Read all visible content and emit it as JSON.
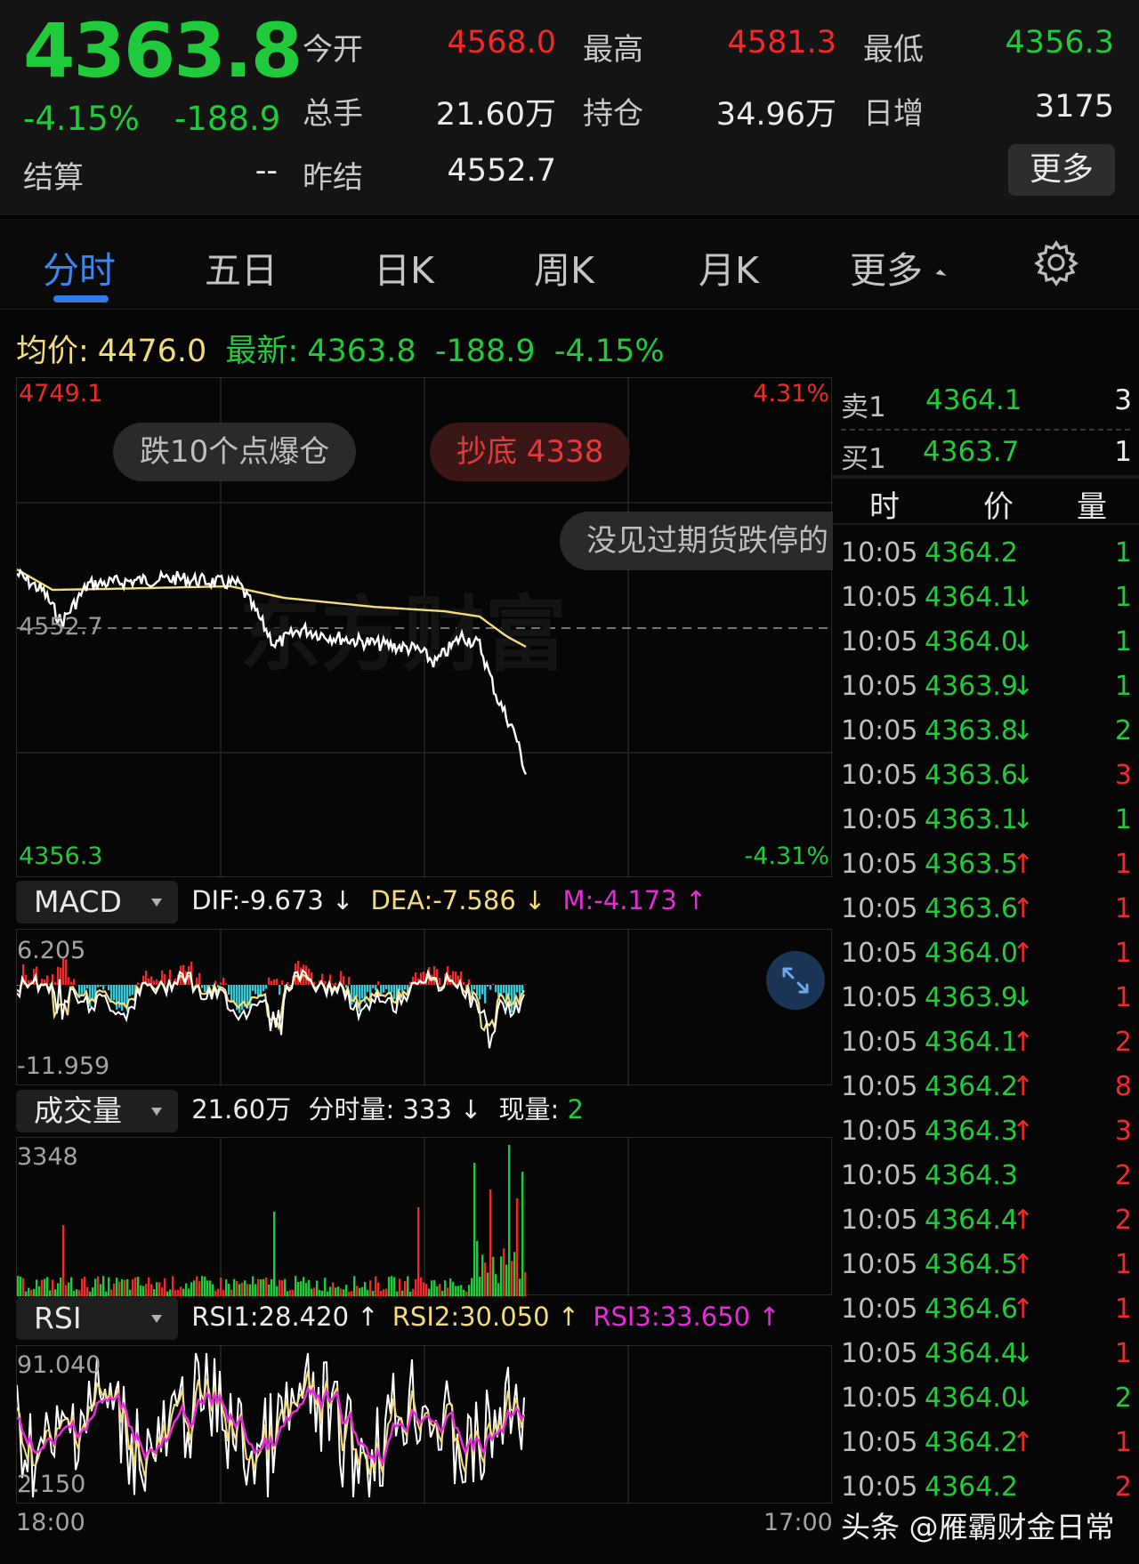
{
  "header": {
    "last_price": "4363.8",
    "change_pct": "-4.15%",
    "change_abs": "-188.9",
    "open_label": "今开",
    "open_value": "4568.0",
    "high_label": "最高",
    "high_value": "4581.3",
    "low_label": "最低",
    "low_value": "4356.3",
    "volume_label": "总手",
    "volume_value": "21.60万",
    "oi_label": "持仓",
    "oi_value": "34.96万",
    "daily_inc_label": "日增",
    "daily_inc_value": "3175",
    "settle_label": "结算",
    "settle_value": "--",
    "prev_settle_label": "昨结",
    "prev_settle_value": "4552.7",
    "more_label": "更多"
  },
  "tabs": [
    "分时",
    "五日",
    "日K",
    "周K",
    "月K",
    "更多"
  ],
  "info_line": {
    "avg_label": "均价:",
    "avg_value": "4476.0",
    "latest_label": "最新:",
    "latest_value": "4363.8",
    "latest_change": "-188.9",
    "latest_pct": "-4.15%"
  },
  "price_chart": {
    "y_max": "4749.1",
    "y_min": "4356.3",
    "pct_max": "4.31%",
    "pct_min": "-4.31%",
    "ref_price": "4552.7",
    "watermark": "东方财富",
    "comments": [
      "跌10个点爆仓",
      "抄底 4338",
      "没见过期货跌停的"
    ]
  },
  "macd": {
    "name": "MACD",
    "dif": "DIF:-9.673 ↓",
    "dea": "DEA:-7.586 ↓",
    "m": "M:-4.173 ↑",
    "y_max": "6.205",
    "y_min": "-11.959"
  },
  "volume": {
    "name": "成交量",
    "total": "21.60万",
    "period_vol": "分时量: 333 ↓",
    "now_label": "现量:",
    "now_value": "2",
    "y_max": "3348"
  },
  "rsi": {
    "name": "RSI",
    "rsi1": "RSI1:28.420 ↑",
    "rsi2": "RSI2:30.050 ↑",
    "rsi3": "RSI3:33.650 ↑",
    "y_max": "91.040",
    "y_min": "2.150"
  },
  "x_axis": {
    "start": "18:00",
    "end": "17:00"
  },
  "order_book": {
    "ask1_label": "卖1",
    "ask1_price": "4364.1",
    "ask1_qty": "3",
    "bid1_label": "买1",
    "bid1_price": "4363.7",
    "bid1_qty": "1",
    "col_time": "时",
    "col_price": "价",
    "col_qty": "量"
  },
  "trades": [
    {
      "time": "10:05",
      "price": "4364.2",
      "dir": "",
      "qty": "1",
      "qty_color": "green"
    },
    {
      "time": "10:05",
      "price": "4364.1",
      "dir": "↓",
      "qty": "1",
      "qty_color": "green"
    },
    {
      "time": "10:05",
      "price": "4364.0",
      "dir": "↓",
      "qty": "1",
      "qty_color": "green"
    },
    {
      "time": "10:05",
      "price": "4363.9",
      "dir": "↓",
      "qty": "1",
      "qty_color": "green"
    },
    {
      "time": "10:05",
      "price": "4363.8",
      "dir": "↓",
      "qty": "2",
      "qty_color": "green"
    },
    {
      "time": "10:05",
      "price": "4363.6",
      "dir": "↓",
      "qty": "3",
      "qty_color": "red"
    },
    {
      "time": "10:05",
      "price": "4363.1",
      "dir": "↓",
      "qty": "1",
      "qty_color": "green"
    },
    {
      "time": "10:05",
      "price": "4363.5",
      "dir": "↑",
      "qty": "1",
      "qty_color": "red"
    },
    {
      "time": "10:05",
      "price": "4363.6",
      "dir": "↑",
      "qty": "1",
      "qty_color": "red"
    },
    {
      "time": "10:05",
      "price": "4364.0",
      "dir": "↑",
      "qty": "1",
      "qty_color": "red"
    },
    {
      "time": "10:05",
      "price": "4363.9",
      "dir": "↓",
      "qty": "1",
      "qty_color": "red"
    },
    {
      "time": "10:05",
      "price": "4364.1",
      "dir": "↑",
      "qty": "2",
      "qty_color": "red"
    },
    {
      "time": "10:05",
      "price": "4364.2",
      "dir": "↑",
      "qty": "8",
      "qty_color": "red"
    },
    {
      "time": "10:05",
      "price": "4364.3",
      "dir": "↑",
      "qty": "3",
      "qty_color": "red"
    },
    {
      "time": "10:05",
      "price": "4364.3",
      "dir": "",
      "qty": "2",
      "qty_color": "red"
    },
    {
      "time": "10:05",
      "price": "4364.4",
      "dir": "↑",
      "qty": "2",
      "qty_color": "red"
    },
    {
      "time": "10:05",
      "price": "4364.5",
      "dir": "↑",
      "qty": "1",
      "qty_color": "red"
    },
    {
      "time": "10:05",
      "price": "4364.6",
      "dir": "↑",
      "qty": "1",
      "qty_color": "red"
    },
    {
      "time": "10:05",
      "price": "4364.4",
      "dir": "↓",
      "qty": "1",
      "qty_color": "red"
    },
    {
      "time": "10:05",
      "price": "4364.0",
      "dir": "↓",
      "qty": "2",
      "qty_color": "green"
    },
    {
      "time": "10:05",
      "price": "4364.2",
      "dir": "↑",
      "qty": "1",
      "qty_color": "red"
    },
    {
      "time": "10:05",
      "price": "4364.2",
      "dir": "",
      "qty": "2",
      "qty_color": "red"
    }
  ],
  "footer_watermark": "头条 @雁霸财金日常",
  "colors": {
    "up": "#f02a2a",
    "down": "#1fcb3b",
    "avg_line": "#f3dc7a",
    "price_line": "#ffffff",
    "accent": "#2e7ce6",
    "macd_pos": "#f02a2a",
    "macd_neg": "#35c8d6",
    "rsi3": "#e62bd9"
  }
}
